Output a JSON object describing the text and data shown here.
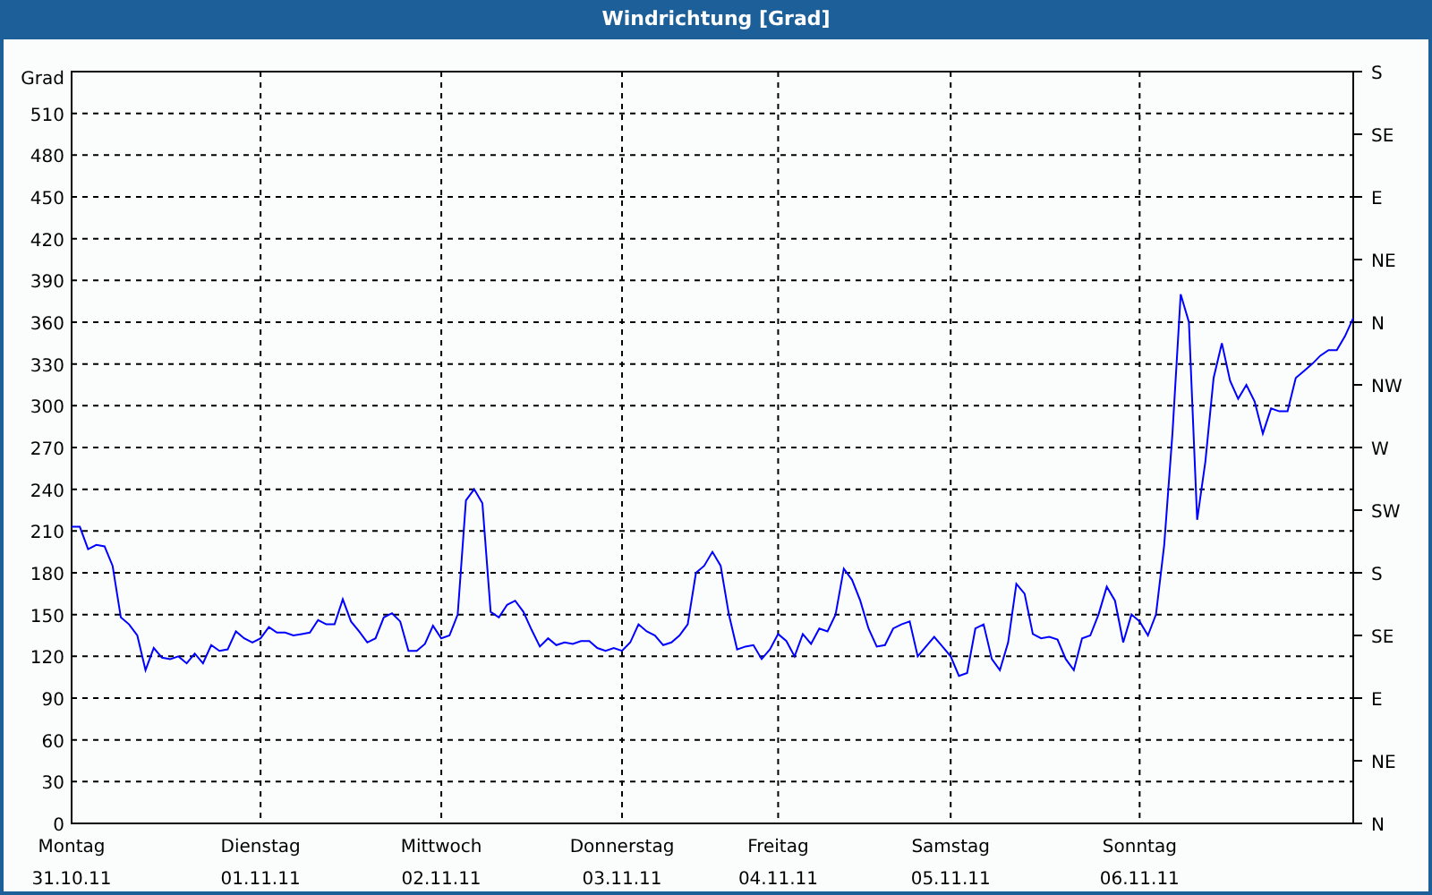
{
  "window": {
    "title": "Windrichtung [Grad]"
  },
  "chart": {
    "unit_label": "Grad",
    "right_axis_labels": [
      "S",
      "SE",
      "E",
      "NE",
      "N",
      "NW",
      "W",
      "SW",
      "S",
      "SE",
      "E",
      "NE",
      "N"
    ],
    "x_dates": [
      "31.10.11",
      "01.11.11",
      "02.11.11",
      "03.11.11",
      "04.11.11",
      "05.11.11",
      "06.11.11"
    ],
    "chart_data": {
      "type": "line",
      "grid": true,
      "ylim": [
        0,
        540
      ],
      "yticks": [
        0,
        30,
        60,
        90,
        120,
        150,
        180,
        210,
        240,
        270,
        300,
        330,
        360,
        390,
        420,
        450,
        480,
        510
      ],
      "categories": [
        "Montag",
        null,
        null,
        null,
        null,
        null,
        null,
        null,
        null,
        null,
        null,
        null,
        null,
        null,
        null,
        null,
        null,
        null,
        null,
        null,
        null,
        null,
        null,
        "Dienstag",
        null,
        null,
        null,
        null,
        null,
        null,
        null,
        null,
        null,
        null,
        null,
        null,
        null,
        null,
        null,
        null,
        null,
        null,
        null,
        null,
        null,
        "Mittwoch",
        null,
        null,
        null,
        null,
        null,
        null,
        null,
        null,
        null,
        null,
        null,
        null,
        null,
        null,
        null,
        null,
        null,
        null,
        null,
        null,
        null,
        "Donnerstag",
        null,
        null,
        null,
        null,
        null,
        null,
        null,
        null,
        null,
        null,
        null,
        null,
        null,
        null,
        null,
        null,
        null,
        null,
        "Freitag",
        null,
        null,
        null,
        null,
        null,
        null,
        null,
        null,
        null,
        null,
        null,
        null,
        null,
        null,
        null,
        null,
        null,
        null,
        null,
        null,
        "Samstag",
        null,
        null,
        null,
        null,
        null,
        null,
        null,
        null,
        null,
        null,
        null,
        null,
        null,
        null,
        null,
        null,
        null,
        null,
        null,
        null,
        null,
        null,
        "Sonntag",
        null,
        null,
        null,
        null,
        null,
        null,
        null,
        null,
        null,
        null,
        null,
        null,
        null,
        null,
        null,
        null,
        null,
        null,
        null,
        null,
        null,
        null,
        null,
        null,
        null,
        null
      ],
      "series": [
        {
          "color": "#0000ff",
          "values": [
            213,
            213,
            197,
            200,
            199,
            185,
            148,
            143,
            135,
            110,
            126,
            119,
            118,
            120,
            115,
            122,
            115,
            128,
            124,
            125,
            138,
            133,
            130,
            133,
            141,
            137,
            137,
            135,
            136,
            137,
            146,
            143,
            143,
            161,
            145,
            138,
            130,
            133,
            148,
            151,
            145,
            124,
            124,
            129,
            142,
            133,
            135,
            150,
            232,
            240,
            230,
            152,
            148,
            157,
            160,
            152,
            139,
            127,
            133,
            128,
            130,
            129,
            131,
            131,
            126,
            124,
            126,
            124,
            130,
            143,
            138,
            135,
            128,
            130,
            135,
            143,
            180,
            185,
            195,
            185,
            150,
            125,
            127,
            128,
            118,
            125,
            136,
            131,
            120,
            136,
            129,
            140,
            138,
            150,
            183,
            175,
            160,
            140,
            127,
            128,
            140,
            143,
            145,
            120,
            127,
            134,
            127,
            120,
            106,
            108,
            140,
            143,
            118,
            110,
            130,
            172,
            165,
            136,
            133,
            134,
            132,
            118,
            110,
            133,
            135,
            150,
            170,
            160,
            130,
            150,
            145,
            135,
            150,
            200,
            280,
            380,
            360,
            218,
            260,
            320,
            345,
            318,
            305,
            315,
            303,
            280,
            298,
            296,
            296,
            320,
            325,
            330,
            336,
            340,
            340,
            350,
            363
          ]
        }
      ]
    }
  }
}
